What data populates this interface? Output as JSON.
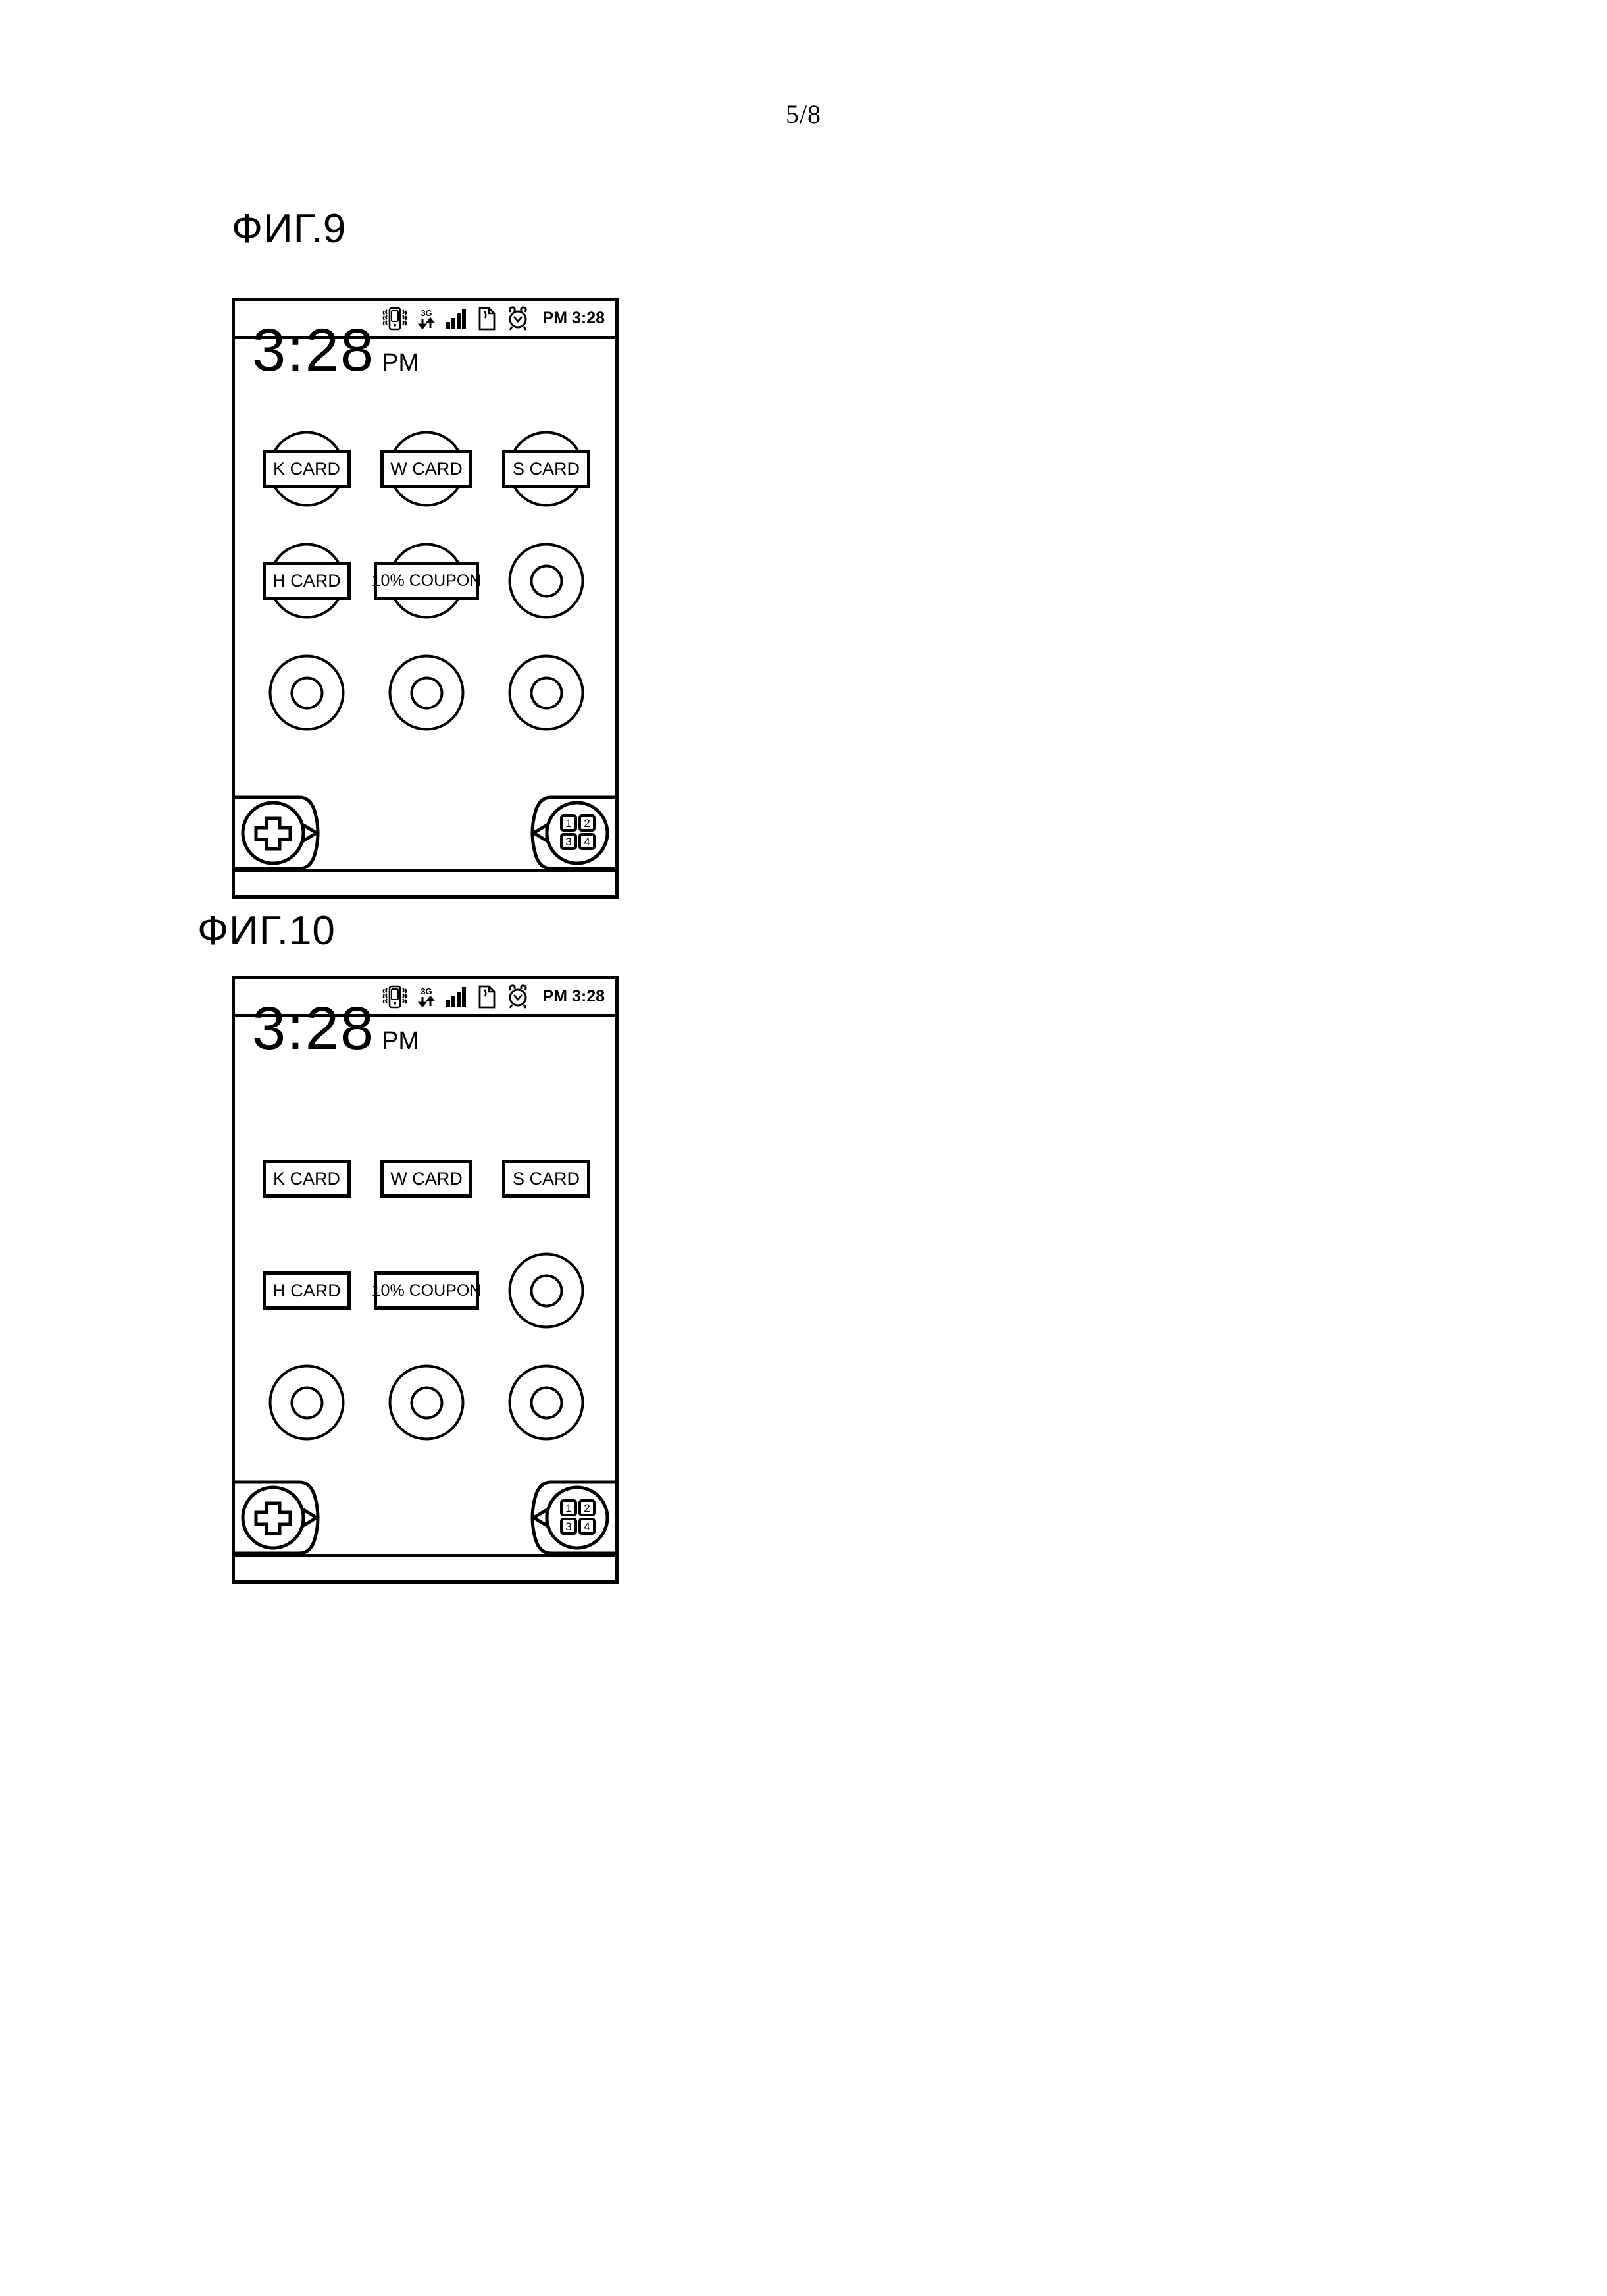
{
  "page": {
    "number": "5/8"
  },
  "figures": [
    {
      "id": "fig9",
      "label": "ФИГ.9",
      "statusbar": {
        "icons": [
          "vibrate-phone-icon",
          "3g-data-icon",
          "signal-bars-icon",
          "memo-note-icon",
          "alarm-clock-icon"
        ],
        "clock": "PM 3:28"
      },
      "bigclock": {
        "time": "3:28",
        "meridiem": "PM"
      },
      "card_style": "circle-behind",
      "widgets": [
        {
          "type": "card",
          "label": "K CARD"
        },
        {
          "type": "card",
          "label": "W CARD"
        },
        {
          "type": "card",
          "label": "S CARD"
        },
        {
          "type": "card",
          "label": "H CARD"
        },
        {
          "type": "card",
          "label": "10% COUPON"
        },
        {
          "type": "empty",
          "label": ""
        },
        {
          "type": "empty",
          "label": ""
        },
        {
          "type": "empty",
          "label": ""
        },
        {
          "type": "empty",
          "label": ""
        }
      ],
      "dock": {
        "left_button": "add-plus-button",
        "left_arrow": "arrow-right-icon",
        "right_button": "app-grid-button",
        "right_arrow": "arrow-left-icon",
        "grid_keys": [
          "1",
          "2",
          "3",
          "4"
        ]
      }
    },
    {
      "id": "fig10",
      "label": "ФИГ.10",
      "statusbar": {
        "icons": [
          "vibrate-phone-icon",
          "3g-data-icon",
          "signal-bars-icon",
          "memo-note-icon",
          "alarm-clock-icon"
        ],
        "clock": "PM 3:28"
      },
      "bigclock": {
        "time": "3:28",
        "meridiem": "PM"
      },
      "card_style": "plain-rectangle",
      "widgets": [
        {
          "type": "card",
          "label": "K CARD"
        },
        {
          "type": "card",
          "label": "W CARD"
        },
        {
          "type": "card",
          "label": "S CARD"
        },
        {
          "type": "card",
          "label": "H CARD"
        },
        {
          "type": "card",
          "label": "10% COUPON"
        },
        {
          "type": "empty",
          "label": ""
        },
        {
          "type": "empty",
          "label": ""
        },
        {
          "type": "empty",
          "label": ""
        },
        {
          "type": "empty",
          "label": ""
        }
      ],
      "dock": {
        "left_button": "add-plus-button",
        "left_arrow": "arrow-right-icon",
        "right_button": "app-grid-button",
        "right_arrow": "arrow-left-icon",
        "grid_keys": [
          "1",
          "2",
          "3",
          "4"
        ]
      }
    }
  ],
  "colors": {
    "ink": "#000000",
    "paper": "#ffffff"
  }
}
